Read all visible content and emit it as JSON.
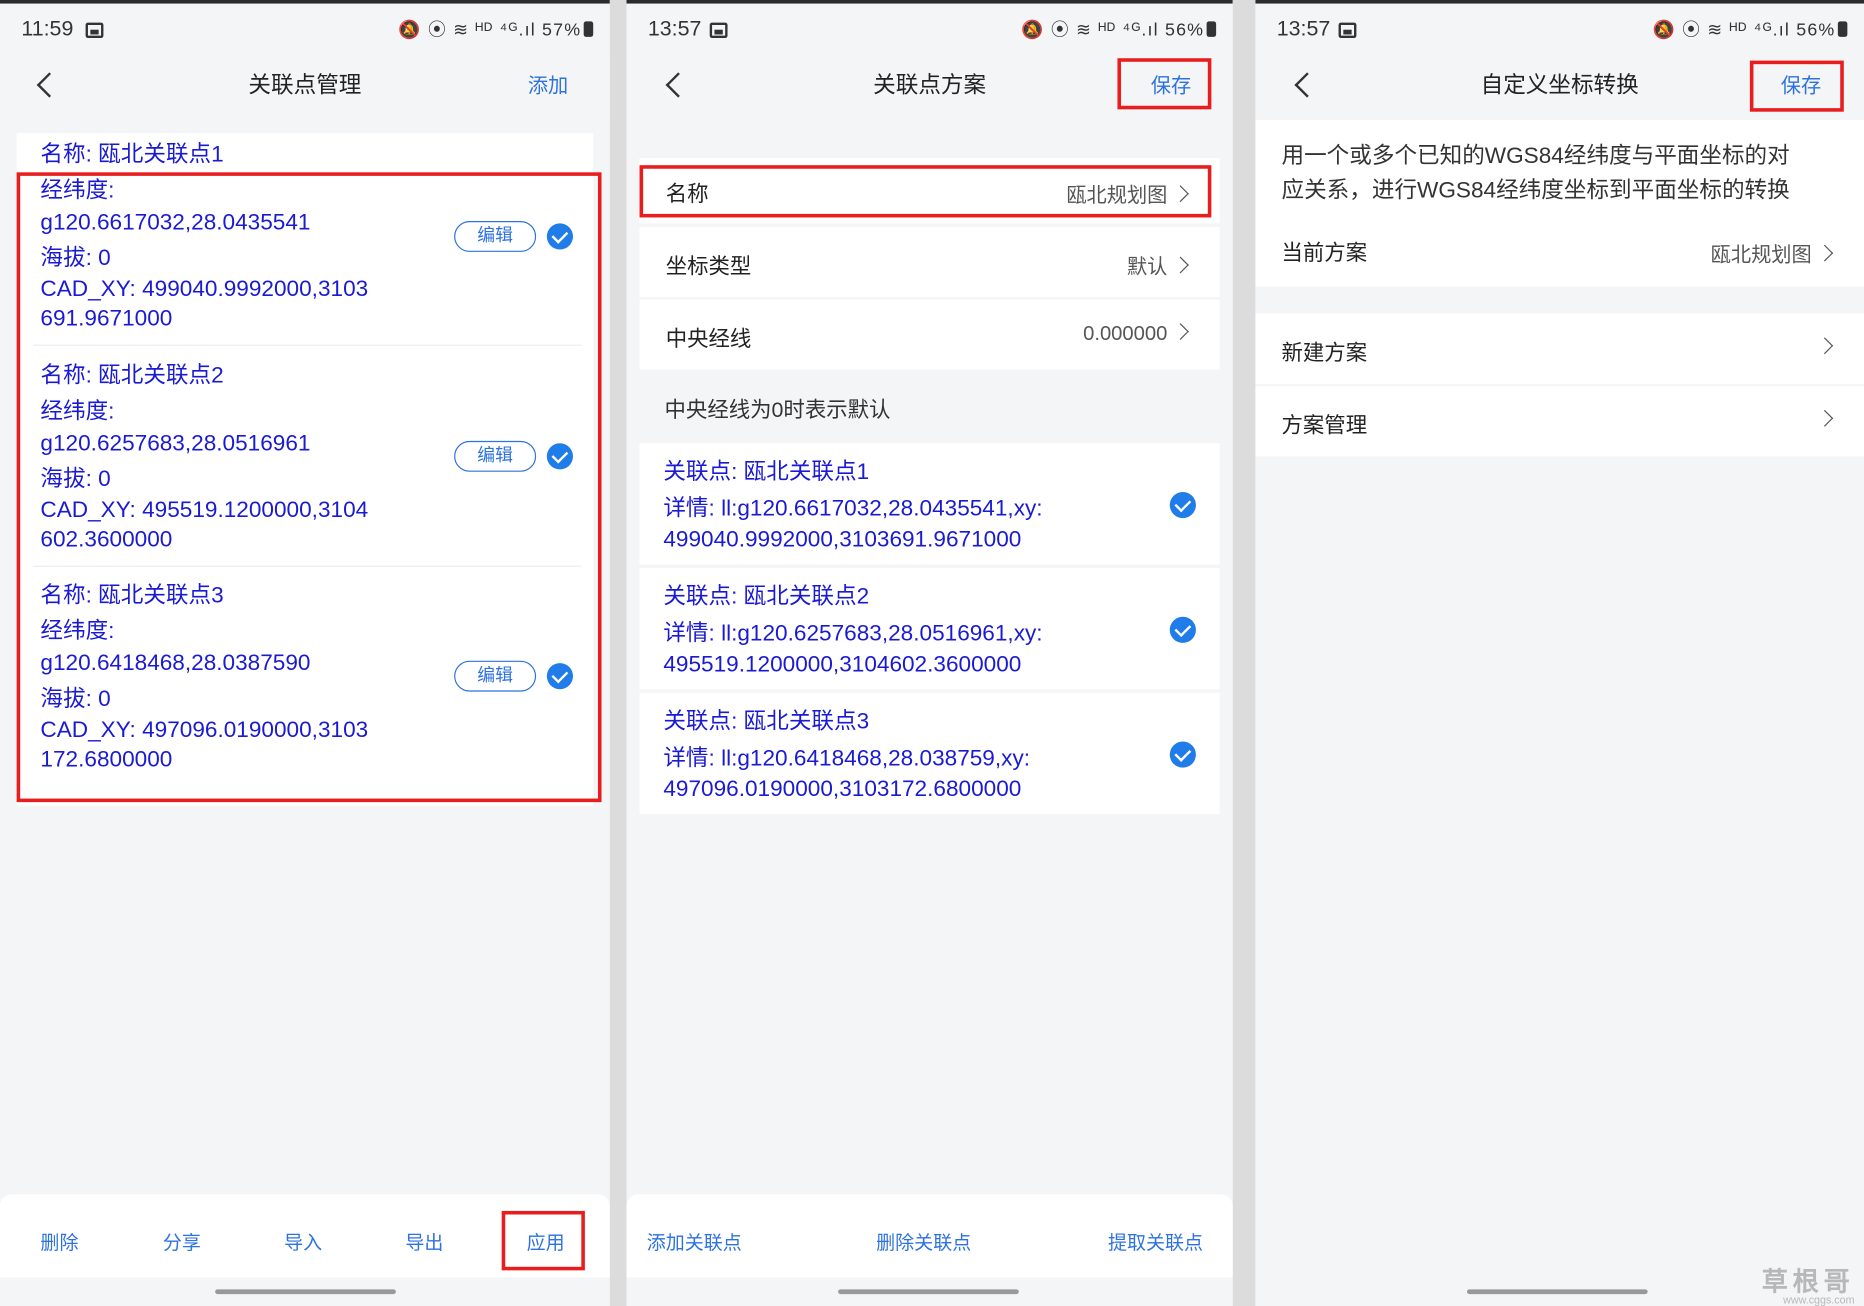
{
  "screens": [
    {
      "status_time": "11:59",
      "status_battery": "57%",
      "title": "关联点管理",
      "header_action": "添加",
      "points": [
        {
          "name": "名称: 瓯北关联点1",
          "ll_label": "经纬度:",
          "ll": "g120.6617032,28.0435541",
          "alt": "海拔: 0",
          "xy1": "CAD_XY: 499040.9992000,3103",
          "xy2": "691.9671000"
        },
        {
          "name": "名称: 瓯北关联点2",
          "ll_label": "经纬度:",
          "ll": "g120.6257683,28.0516961",
          "alt": "海拔: 0",
          "xy1": "CAD_XY: 495519.1200000,3104",
          "xy2": "602.3600000"
        },
        {
          "name": "名称: 瓯北关联点3",
          "ll_label": "经纬度:",
          "ll": "g120.6418468,28.0387590",
          "alt": "海拔: 0",
          "xy1": "CAD_XY: 497096.0190000,3103",
          "xy2": "172.6800000"
        }
      ],
      "edit_label": "编辑",
      "bottom": [
        "删除",
        "分享",
        "导入",
        "导出",
        "应用"
      ]
    },
    {
      "status_time": "13:57",
      "status_battery": "56%",
      "title": "关联点方案",
      "header_action": "保存",
      "rows": [
        {
          "label": "名称",
          "value": "瓯北规划图"
        },
        {
          "label": "坐标类型",
          "value": "默认"
        },
        {
          "label": "中央经线",
          "value": "0.000000"
        }
      ],
      "hint": "中央经线为0时表示默认",
      "points": [
        {
          "title": "关联点: 瓯北关联点1",
          "d1": "详情: ll:g120.6617032,28.0435541,xy:",
          "d2": "499040.9992000,3103691.9671000"
        },
        {
          "title": "关联点: 瓯北关联点2",
          "d1": "详情: ll:g120.6257683,28.0516961,xy:",
          "d2": "495519.1200000,3104602.3600000"
        },
        {
          "title": "关联点: 瓯北关联点3",
          "d1": "详情: ll:g120.6418468,28.038759,xy:",
          "d2": "497096.0190000,3103172.6800000"
        }
      ],
      "bottom": [
        "添加关联点",
        "删除关联点",
        "提取关联点"
      ]
    },
    {
      "status_time": "13:57",
      "status_battery": "56%",
      "title": "自定义坐标转换",
      "header_action": "保存",
      "desc1": "用一个或多个已知的WGS84经纬度与平面坐标的对",
      "desc2": "应关系，进行WGS84经纬度坐标到平面坐标的转换",
      "current_label": "当前方案",
      "current_value": "瓯北规划图",
      "menu": [
        "新建方案",
        "方案管理"
      ]
    }
  ],
  "status_icons": "🔕 ⦿ ≋ ᴴᴰ ⁴ᴳ.ıl",
  "watermark": "草根哥",
  "watermark_url": "www.cggs.com"
}
